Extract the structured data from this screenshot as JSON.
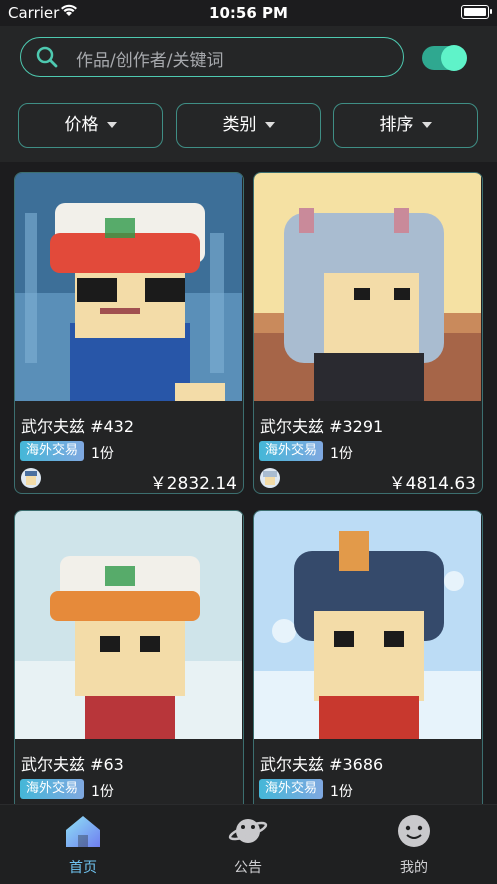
{
  "status_bar": {
    "carrier": "Carrier",
    "time": "10:56 PM"
  },
  "search": {
    "placeholder": "作品/创作者/关键词",
    "icon": "search-icon"
  },
  "toggle": {
    "on": true,
    "color": "#5ff3c9"
  },
  "filters": [
    {
      "label": "价格"
    },
    {
      "label": "类别"
    },
    {
      "label": "排序"
    }
  ],
  "cards": [
    {
      "name": "武尔夫兹 #432",
      "tag": "海外交易",
      "qty": "1份",
      "price": "￥2832.14"
    },
    {
      "name": "武尔夫兹 #3291",
      "tag": "海外交易",
      "qty": "1份",
      "price": "￥4814.63"
    },
    {
      "name": "武尔夫兹 #63",
      "tag": "海外交易",
      "qty": "1份"
    },
    {
      "name": "武尔夫兹 #3686",
      "tag": "海外交易",
      "qty": "1份"
    }
  ],
  "tabbar": [
    {
      "label": "首页",
      "icon": "home-icon",
      "active": true
    },
    {
      "label": "公告",
      "icon": "planet-icon",
      "active": false
    },
    {
      "label": "我的",
      "icon": "smiley-icon",
      "active": false
    }
  ],
  "colors": {
    "accent": "#4ec9b0",
    "active_tab": "#6fc3f0",
    "background": "#1c1c1e"
  }
}
